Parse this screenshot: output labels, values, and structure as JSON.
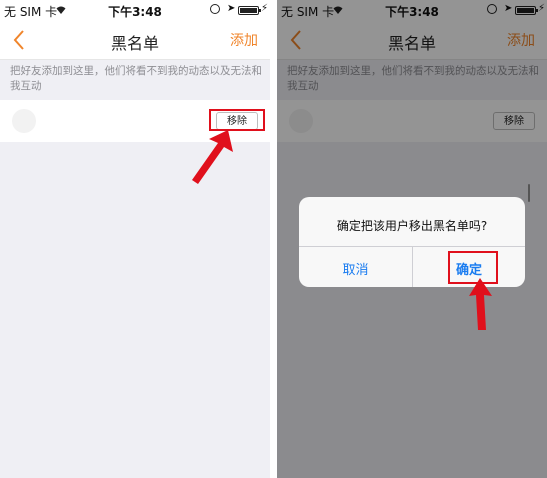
{
  "statusbar": {
    "carrier": "无 SIM 卡",
    "time": "下午3:48"
  },
  "navbar": {
    "title": "黑名单",
    "add_label": "添加"
  },
  "hint_text": "把好友添加到这里，他们将看不到我的动态以及无法和我互动",
  "row": {
    "remove_label": "移除"
  },
  "dialog": {
    "message": "确定把该用户移出黑名单吗?",
    "cancel_label": "取消",
    "confirm_label": "确定"
  },
  "colors": {
    "accent_orange": "#f0852b",
    "highlight_red": "#e0101c",
    "ios_blue": "#1a7cf0",
    "background_gray": "#efeff4"
  },
  "icons": [
    "back-chevron-icon",
    "wifi-icon",
    "lock-rotation-icon",
    "location-icon",
    "battery-icon",
    "charging-icon",
    "red-arrow-icon"
  ]
}
